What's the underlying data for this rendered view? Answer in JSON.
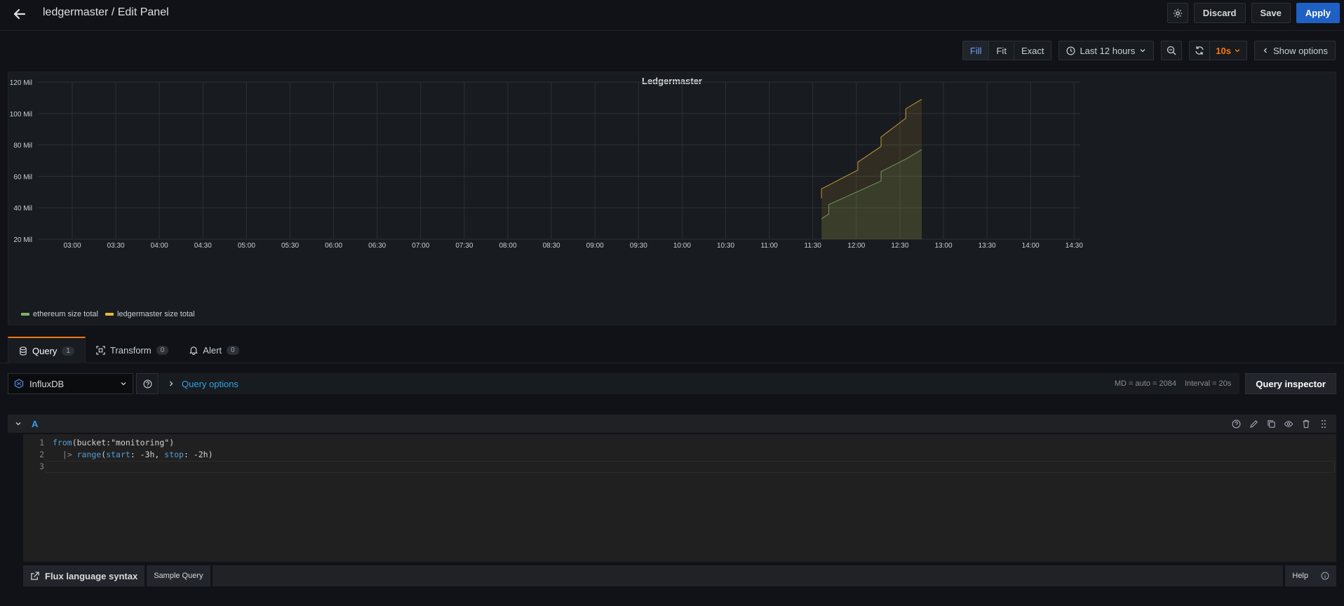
{
  "header": {
    "title": "ledgermaster / Edit Panel",
    "discard": "Discard",
    "save": "Save",
    "apply": "Apply"
  },
  "toolbar": {
    "fill": "Fill",
    "fit": "Fit",
    "exact": "Exact",
    "time_range": "Last 12 hours",
    "refresh_interval": "10s",
    "show_options": "Show options"
  },
  "panel": {
    "title": "Ledgermaster"
  },
  "chart_data": {
    "type": "area",
    "title": "Ledgermaster",
    "x_ticks": [
      "03:00",
      "03:30",
      "04:00",
      "04:30",
      "05:00",
      "05:30",
      "06:00",
      "06:30",
      "07:00",
      "07:30",
      "08:00",
      "08:30",
      "09:00",
      "09:30",
      "10:00",
      "10:30",
      "11:00",
      "11:30",
      "12:00",
      "12:30",
      "13:00",
      "13:30",
      "14:00",
      "14:30"
    ],
    "y_ticks": [
      "20 Mil",
      "40 Mil",
      "60 Mil",
      "80 Mil",
      "100 Mil",
      "120 Mil"
    ],
    "ylim": [
      20,
      120
    ],
    "legend_position": "bottom-left",
    "grid": true,
    "series": [
      {
        "name": "ledgermaster size total",
        "color": "#eab839",
        "points": [
          [
            "11:36",
            46
          ],
          [
            "11:36",
            52
          ],
          [
            "12:01",
            64
          ],
          [
            "12:01",
            69
          ],
          [
            "12:17",
            79
          ],
          [
            "12:17",
            85
          ],
          [
            "12:34",
            97
          ],
          [
            "12:34",
            103
          ],
          [
            "12:45",
            109
          ]
        ]
      },
      {
        "name": "ethereum size total",
        "color": "#7eb26d",
        "points": [
          [
            "11:36",
            33
          ],
          [
            "11:41",
            36
          ],
          [
            "11:41",
            42
          ],
          [
            "12:17",
            57
          ],
          [
            "12:17",
            63
          ],
          [
            "12:34",
            71
          ],
          [
            "12:45",
            77
          ]
        ]
      }
    ]
  },
  "tabs": [
    {
      "label": "Query",
      "count": "1"
    },
    {
      "label": "Transform",
      "count": "0"
    },
    {
      "label": "Alert",
      "count": "0"
    }
  ],
  "query": {
    "datasource": "InfluxDB",
    "options_label": "Query options",
    "md": "MD = auto = 2084",
    "interval": "Interval = 20s",
    "inspector": "Query inspector",
    "ref_id": "A",
    "line_numbers": [
      "1",
      "2",
      "3"
    ],
    "code": {
      "l1_kw": "from",
      "l1_rest": "(bucket:",
      "l1_str": "\"monitoring\"",
      "l1_end": ")",
      "l2_pipe": "  |> ",
      "l2_fn": "range",
      "l2_a": "(",
      "l2_start": "start",
      "l2_b": ": -3h, ",
      "l2_stop": "stop",
      "l2_c": ": -2h)"
    }
  },
  "footer": {
    "flux_syntax": "Flux language syntax",
    "sample_query": "Sample Query",
    "help": "Help"
  }
}
